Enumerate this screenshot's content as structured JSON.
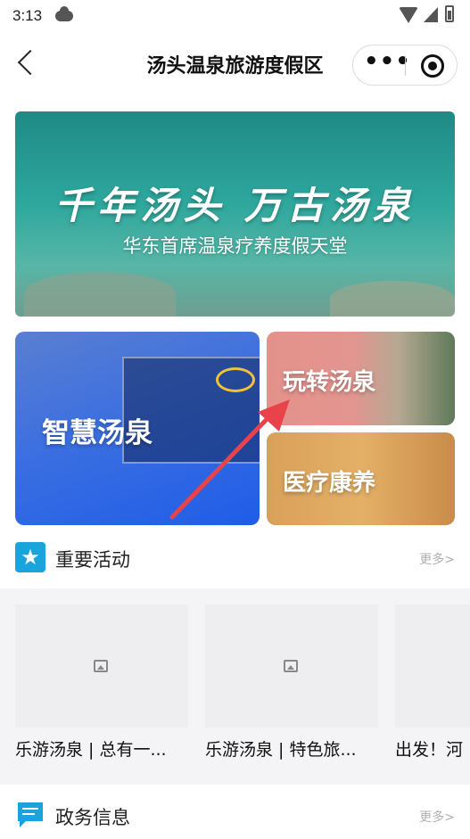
{
  "status_bar": {
    "time": "3:13"
  },
  "nav": {
    "title": "汤头温泉旅游度假区",
    "more_label": "•••"
  },
  "banner": {
    "slogan": "千年汤头 万古汤泉",
    "subtitle": "华东首席温泉疗养度假天堂"
  },
  "tiles": {
    "smart": "智慧汤泉",
    "play": "玩转汤泉",
    "medical": "医疗康养"
  },
  "sections": {
    "activities": {
      "title": "重要活动",
      "more": "更多>"
    },
    "government": {
      "title": "政务信息",
      "more": "更多>"
    }
  },
  "cards": [
    {
      "caption": "乐游汤泉 | 总有一..."
    },
    {
      "caption": "乐游汤泉 | 特色旅..."
    },
    {
      "caption": "出发！河"
    }
  ],
  "colors": {
    "accent": "#1ba4dc",
    "arrow": "#e8434a"
  }
}
